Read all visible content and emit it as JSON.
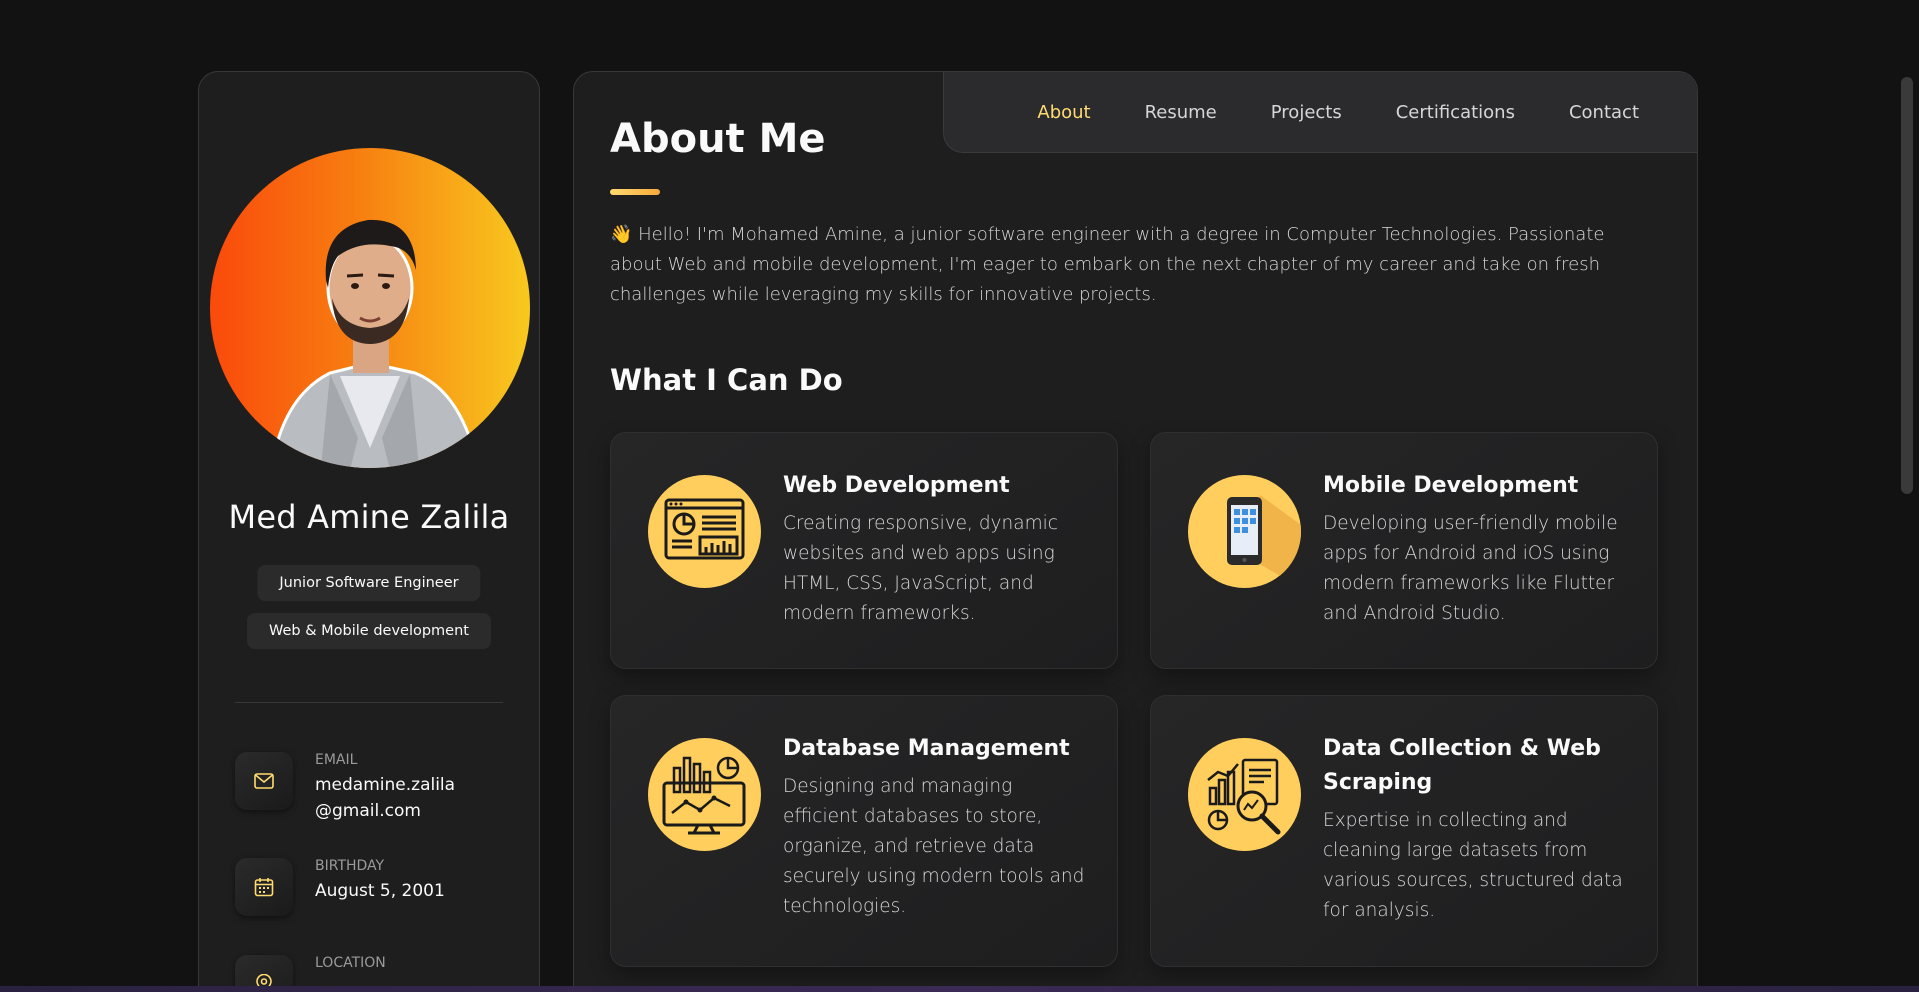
{
  "sidebar": {
    "name": "Med Amine Zalila",
    "tags": [
      "Junior Software Engineer",
      "Web & Mobile development"
    ],
    "contacts": [
      {
        "label": "Email",
        "value_line1": "medamine.zalila",
        "value_line2": "@gmail.com",
        "icon": "mail-icon"
      },
      {
        "label": "Birthday",
        "value_line1": "August 5, 2001",
        "icon": "calendar-icon"
      },
      {
        "label": "Location",
        "value_line1": "",
        "icon": "location-pin-icon"
      }
    ]
  },
  "nav": {
    "items": [
      "About",
      "Resume",
      "Projects",
      "Certifications",
      "Contact"
    ],
    "active": "About"
  },
  "about": {
    "title": "About Me",
    "text": "👋 Hello! I'm Mohamed Amine, a junior software engineer with a degree in Computer Technologies. Passionate about Web and mobile development, I'm eager to embark on the next chapter of my career and take on fresh challenges while leveraging my skills for innovative projects."
  },
  "services": {
    "title": "What I Can Do",
    "items": [
      {
        "title": "Web Development",
        "text": "Creating responsive, dynamic websites and web apps using HTML, CSS, JavaScript, and modern frameworks.",
        "icon": "web-dashboard-icon"
      },
      {
        "title": "Mobile Development",
        "text": "Developing user-friendly mobile apps for Android and iOS using modern frameworks like Flutter and Android Studio.",
        "icon": "smartphone-icon"
      },
      {
        "title": "Database Management",
        "text": "Designing and managing efficient databases to store, organize, and retrieve data securely using modern tools and technologies.",
        "icon": "database-monitor-icon"
      },
      {
        "title": "Data Collection & Web Scraping",
        "text": "Expertise in collecting and cleaning large datasets from various sources, structured data for analysis.",
        "icon": "data-magnifier-icon"
      }
    ]
  },
  "colors": {
    "accent": "#ffdb70",
    "background": "#121212",
    "panel": "#1e1e1f"
  }
}
